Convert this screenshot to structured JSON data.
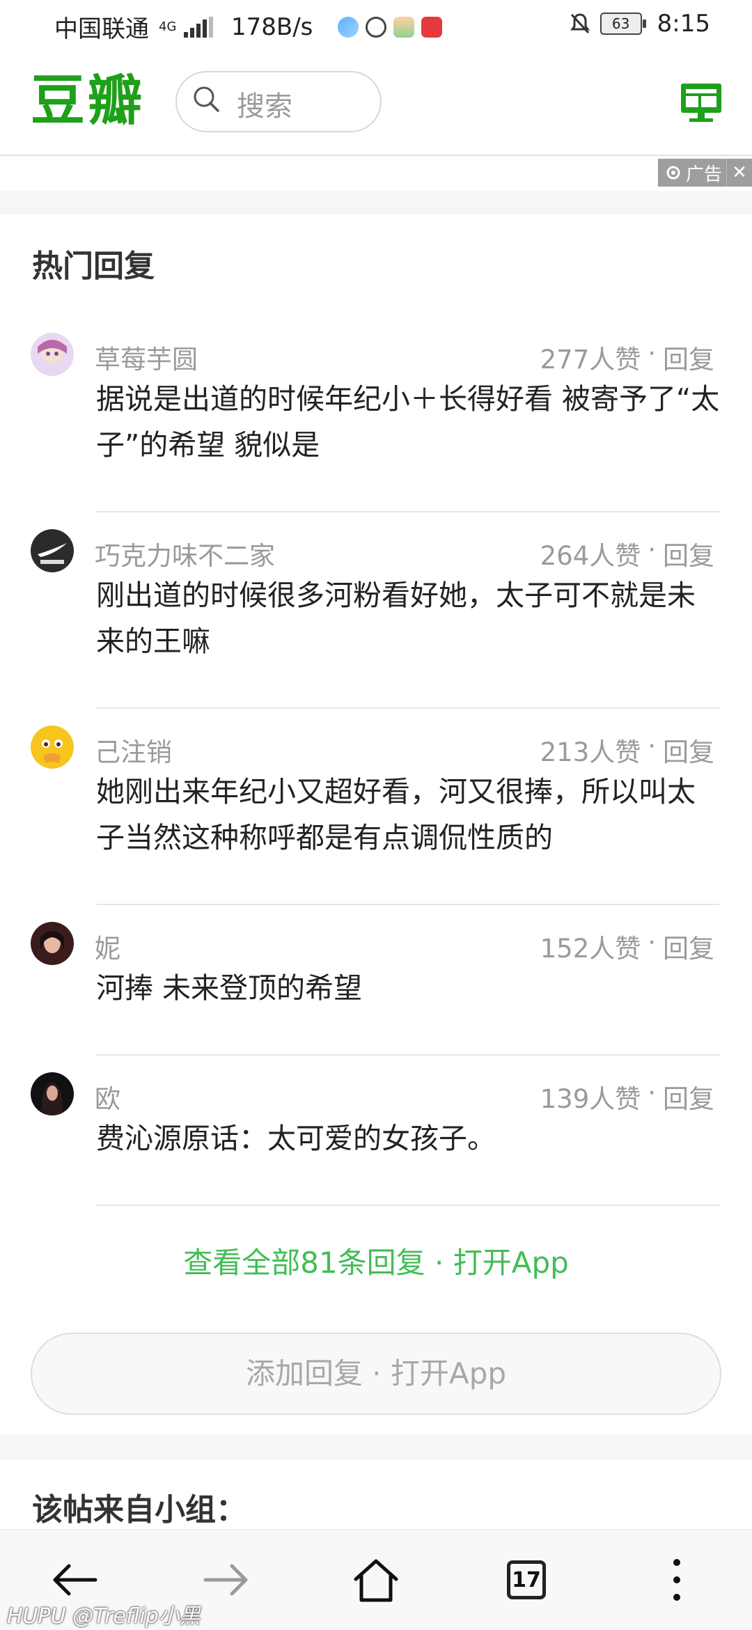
{
  "status_bar": {
    "carrier": "中国联通",
    "network": "4G",
    "speed": "178B/s",
    "battery": "63",
    "time": "8:15"
  },
  "header": {
    "logo": "豆瓣",
    "search_placeholder": "搜索",
    "brand_color": "#1ea01a"
  },
  "ad": {
    "label": "广告",
    "close": "✕"
  },
  "hot_replies": {
    "title": "热门回复",
    "items": [
      {
        "user": "草莓芋圆",
        "likes": "277人赞",
        "reply": "回复",
        "text": "据说是出道的时候年纪小＋长得好看 被寄予了“太子”的希望 貌似是"
      },
      {
        "user": "巧克力味不二家",
        "likes": "264人赞",
        "reply": "回复",
        "text": "刚出道的时候很多河粉看好她，太子可不就是未来的王嘛"
      },
      {
        "user": "己注销",
        "likes": "213人赞",
        "reply": "回复",
        "text": "她刚出来年纪小又超好看，河又很捧，所以叫太子当然这种称呼都是有点调侃性质的"
      },
      {
        "user": "妮",
        "likes": "152人赞",
        "reply": "回复",
        "text": "河捧 未来登顶的希望"
      },
      {
        "user": "欧",
        "likes": "139人赞",
        "reply": "回复",
        "text": "费沁源原话：太可爱的女孩子。"
      }
    ],
    "view_all": "查看全部81条回复 · 打开App",
    "add_reply": "添加回复 · 打开App"
  },
  "group_section": {
    "title": "该帖来自小组："
  },
  "browser_nav": {
    "tab_count": "17"
  },
  "watermark": "HUPU @Treflip小黑"
}
